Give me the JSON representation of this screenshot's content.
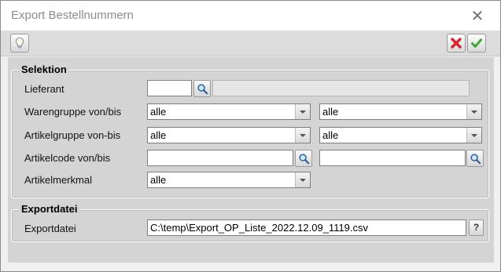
{
  "window": {
    "title": "Export Bestellnummern"
  },
  "icons": {
    "close": "close-icon",
    "info": "lightbulb-icon",
    "cancel": "red-x-icon",
    "ok": "green-check-icon",
    "search": "magnifier-icon",
    "dropdown": "chevron-down-icon"
  },
  "colors": {
    "cancel": "#d9232e",
    "ok": "#3fa535"
  },
  "selektion": {
    "title": "Selektion",
    "lieferant": {
      "label": "Lieferant",
      "value": "",
      "name": ""
    },
    "warengruppe": {
      "label": "Warengruppe von/bis",
      "from": "alle",
      "to": "alle"
    },
    "artikelgruppe": {
      "label": "Artikelgruppe von-bis",
      "from": "alle",
      "to": "alle"
    },
    "artikelcode": {
      "label": "Artikelcode von/bis",
      "from": "",
      "to": ""
    },
    "artikelmerkmal": {
      "label": "Artikelmerkmal",
      "value": "alle"
    }
  },
  "exportdatei": {
    "title": "Exportdatei",
    "label": "Exportdatei",
    "path": "C:\\temp\\Export_OP_Liste_2022.12.09_1119.csv",
    "help_label": "?"
  }
}
